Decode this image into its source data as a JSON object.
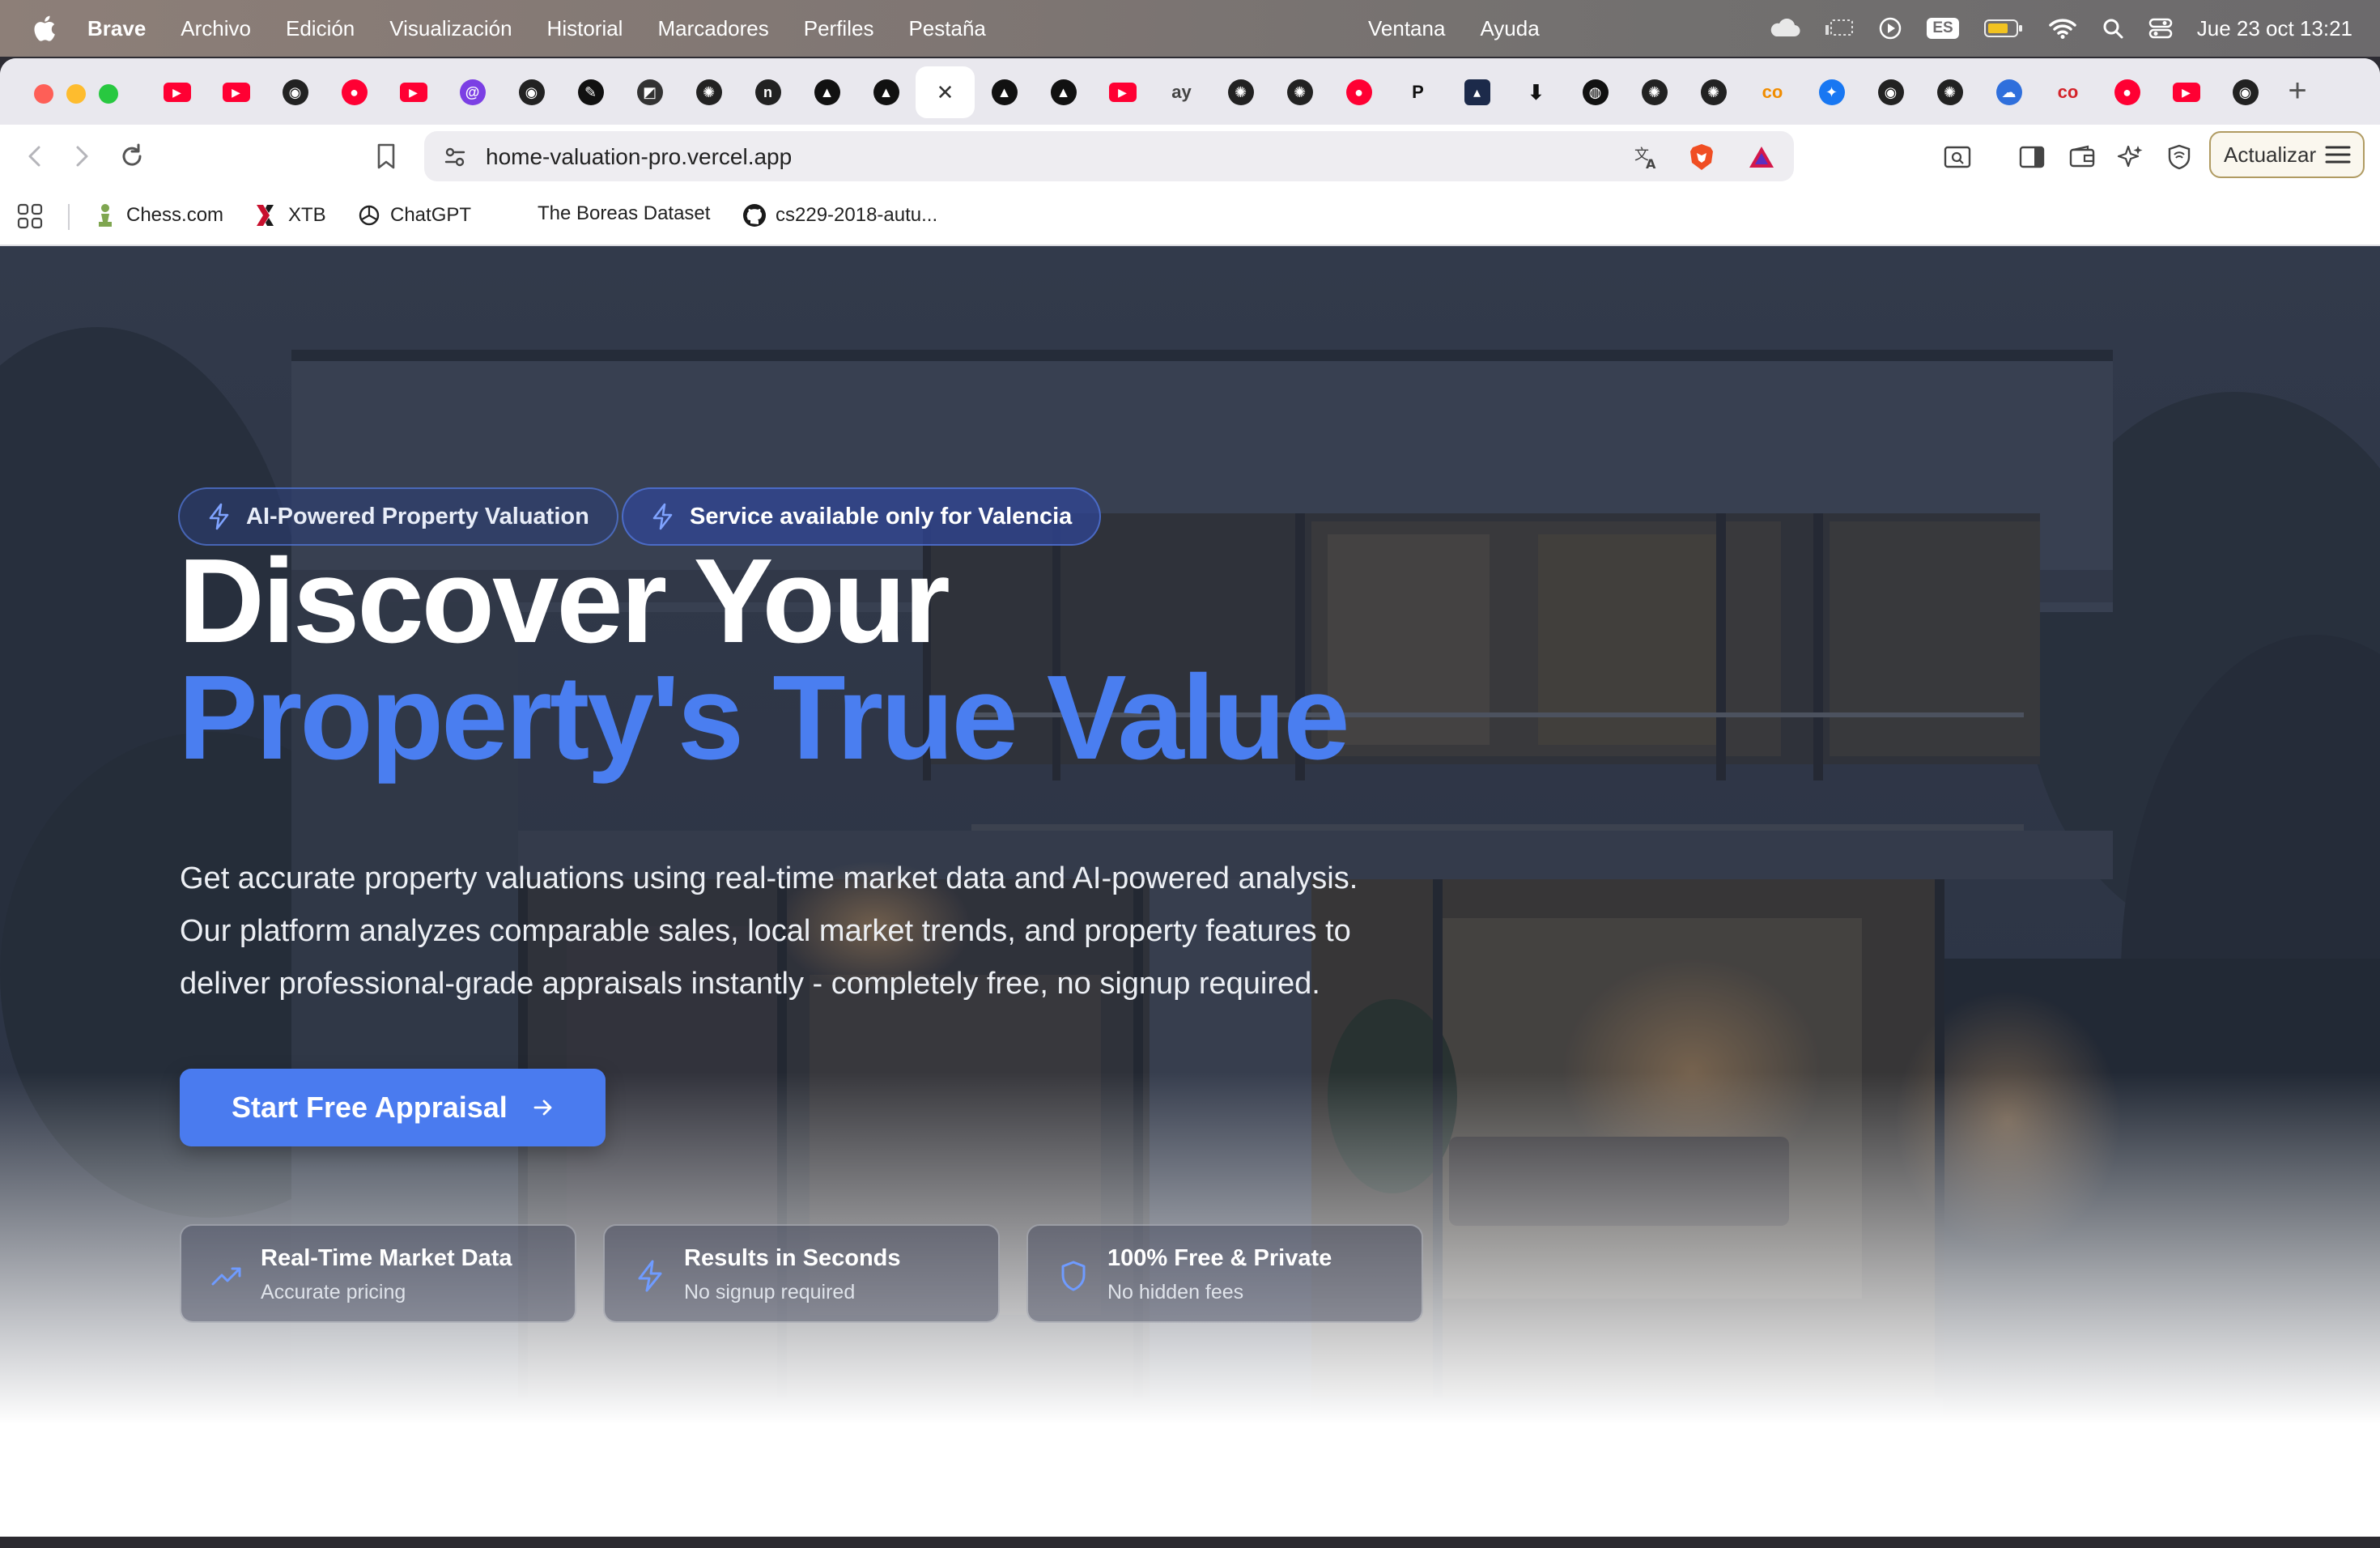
{
  "menubar": {
    "app_name": "Brave",
    "menus": [
      "Archivo",
      "Edición",
      "Visualización",
      "Historial",
      "Marcadores",
      "Perfiles",
      "Pestaña"
    ],
    "center_menus": [
      "Ventana",
      "Ayuda"
    ],
    "language": "ES",
    "datetime": "Jue 23 oct 13:21"
  },
  "tabs": [
    {
      "icon": "youtube-icon",
      "color": "#ff0033"
    },
    {
      "icon": "youtube-icon",
      "color": "#ff0033"
    },
    {
      "icon": "github-icon",
      "color": "#222222"
    },
    {
      "icon": "youtube-record-icon",
      "color": "#ff0033"
    },
    {
      "icon": "youtube-icon",
      "color": "#ff0033"
    },
    {
      "icon": "purple-swirl-icon",
      "color": "#7b3fe4"
    },
    {
      "icon": "github-icon",
      "color": "#222222"
    },
    {
      "icon": "link-icon",
      "color": "#111111"
    },
    {
      "icon": "diagonal-square-icon",
      "color": "#333333"
    },
    {
      "icon": "openai-icon",
      "color": "#222222"
    },
    {
      "icon": "n-letter-icon",
      "color": "#222222"
    },
    {
      "icon": "triangle-green-icon",
      "color": "#111111"
    },
    {
      "icon": "triangle-icon",
      "color": "#111111"
    },
    {
      "icon": "close-icon",
      "color": "#333333",
      "active": true
    },
    {
      "icon": "triangle-icon",
      "color": "#111111"
    },
    {
      "icon": "triangle-icon",
      "color": "#111111"
    },
    {
      "icon": "youtube-icon",
      "color": "#ff0033"
    },
    {
      "icon": "text-logo-icon",
      "color": "#444444"
    },
    {
      "icon": "openai-icon",
      "color": "#222222"
    },
    {
      "icon": "openai-icon",
      "color": "#222222"
    },
    {
      "icon": "youtube-record-icon",
      "color": "#ff0033"
    },
    {
      "icon": "p-letter-icon",
      "color": "#111111"
    },
    {
      "icon": "dark-square-icon",
      "color": "#1c2a4a"
    },
    {
      "icon": "arrow-down-icon",
      "color": "#111111"
    },
    {
      "icon": "circle-badge-icon",
      "color": "#111111"
    },
    {
      "icon": "openai-icon",
      "color": "#222222"
    },
    {
      "icon": "openai-icon",
      "color": "#222222"
    },
    {
      "icon": "cc-logo-icon",
      "color": "#f08c00"
    },
    {
      "icon": "butterfly-icon",
      "color": "#1877f2"
    },
    {
      "icon": "github-icon",
      "color": "#222222"
    },
    {
      "icon": "openai-icon",
      "color": "#222222"
    },
    {
      "icon": "cloud-blue-icon",
      "color": "#2f6fdc"
    },
    {
      "icon": "co-logo-icon",
      "color": "#d4232a"
    },
    {
      "icon": "youtube-record-icon",
      "color": "#ff0033"
    },
    {
      "icon": "youtube-icon",
      "color": "#ff0033"
    },
    {
      "icon": "github-icon",
      "color": "#222222"
    }
  ],
  "address_bar": {
    "url": "home-valuation-pro.vercel.app"
  },
  "toolbar": {
    "update_label": "Actualizar"
  },
  "bookmarks": [
    {
      "label": "Chess.com",
      "icon": "chess-pawn-icon"
    },
    {
      "label": "XTB",
      "icon": "xtb-logo-icon"
    },
    {
      "label": "ChatGPT",
      "icon": "openai-icon"
    },
    {
      "label": "The Boreas Dataset",
      "icon": ""
    },
    {
      "label": "cs229-2018-autu...",
      "icon": "github-icon"
    }
  ],
  "hero": {
    "badge_1": "AI-Powered Property Valuation",
    "badge_2": "Service available only for Valencia",
    "headline_1": "Discover Your",
    "headline_2": "Property's True Value",
    "description_lines": [
      "Get accurate property valuations using real-time market data and AI-powered analysis.",
      "Our platform analyzes comparable sales, local market trends, and property features to",
      "deliver professional-grade appraisals instantly - completely free, no signup required."
    ],
    "cta_label": "Start Free Appraisal",
    "features": [
      {
        "title": "Real-Time Market Data",
        "subtitle": "Accurate pricing",
        "icon": "trending-up-icon"
      },
      {
        "title": "Results in Seconds",
        "subtitle": "No signup required",
        "icon": "lightning-icon"
      },
      {
        "title": "100% Free & Private",
        "subtitle": "No hidden fees",
        "icon": "shield-icon"
      }
    ]
  },
  "colors": {
    "accent": "#4a7bef",
    "headline_accent": "#4a7ef0"
  }
}
